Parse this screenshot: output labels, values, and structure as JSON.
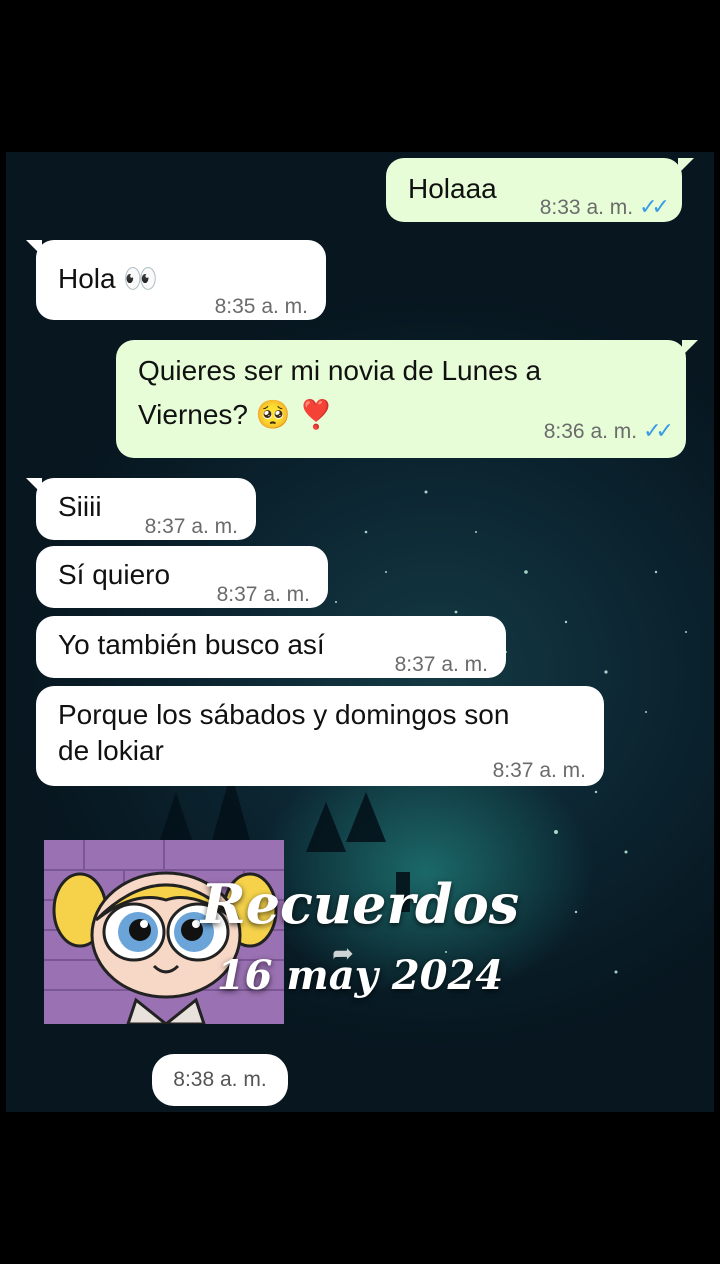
{
  "messages": [
    {
      "dir": "out",
      "text": "Holaaa",
      "time": "8:33 a. m.",
      "read_icon": "double-check-icon"
    },
    {
      "dir": "in",
      "text": "Hola",
      "emoji": "👀",
      "time": "8:35 a. m."
    },
    {
      "dir": "out",
      "line1": "Quieres ser mi novia de Lunes a",
      "line2": "Viernes?",
      "emoji": "🥺 ❣️",
      "time": "8:36 a. m.",
      "read_icon": "double-check-icon"
    },
    {
      "dir": "in",
      "text": "Siiii",
      "time": "8:37 a. m."
    },
    {
      "dir": "in",
      "text": "Sí quiero",
      "time": "8:37 a. m."
    },
    {
      "dir": "in",
      "text": "Yo también busco así",
      "time": "8:37 a. m."
    },
    {
      "dir": "in",
      "line1": "Porque los sábados y domingos son",
      "line2": "de lokiar",
      "time": "8:37 a. m."
    }
  ],
  "sticker": {
    "description_icon": "bubbles-cartoon-sticker",
    "time": "8:38 a. m."
  },
  "overlay": {
    "title": "Recuerdos",
    "date": "16 may 2024",
    "forward_icon": "forward-icon"
  },
  "colors": {
    "outgoing": "#e6fdd7",
    "incoming": "#ffffff",
    "read_ticks": "#3a9be6",
    "background": "#000000"
  }
}
